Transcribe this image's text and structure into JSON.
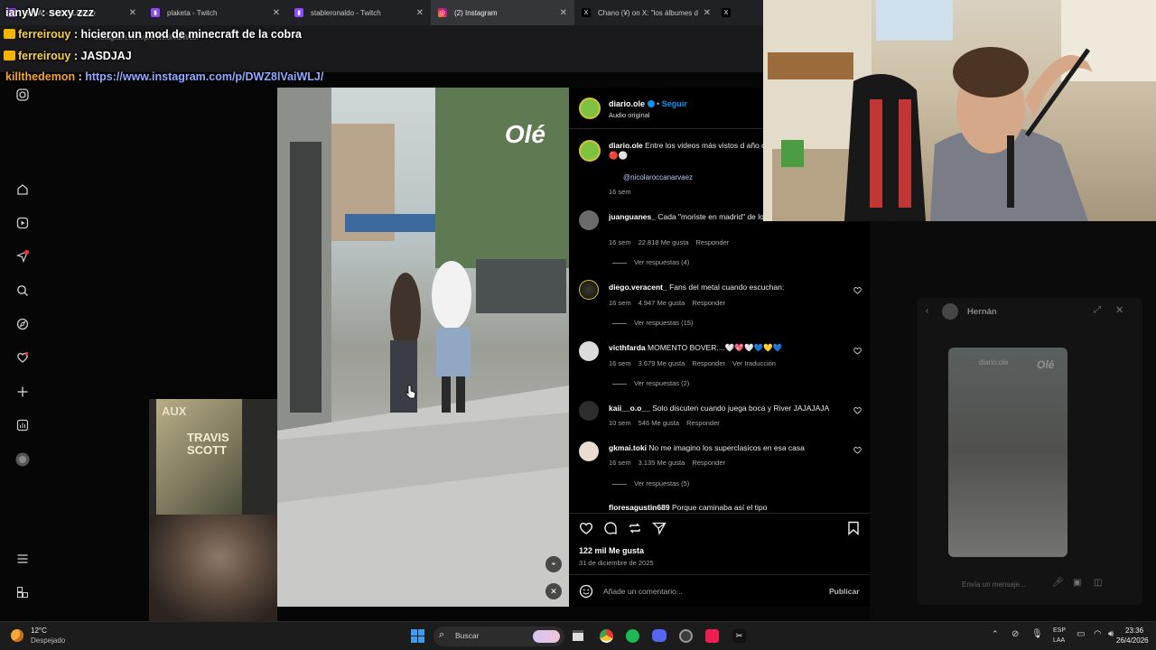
{
  "tabs": [
    {
      "label": "lanyW - Watch Live on"
    },
    {
      "label": "plaketa - Twitch"
    },
    {
      "label": "stableronaldo - Twitch"
    },
    {
      "label": "(2) Instagram"
    },
    {
      "label": "Chano (¥) on X: \"los álbumes de"
    }
  ],
  "url": "instagram.com/p/DWZ8lVaiWLJ/",
  "chat": [
    {
      "user": "ianyW",
      "msg": "sexy zzz"
    },
    {
      "user": "ferreirouy",
      "msg": "hicieron un mod de minecraft de la cobra"
    },
    {
      "user": "ferreirouy",
      "msg": "JASDJAJ"
    },
    {
      "user": "killthedemon",
      "msg": "https://www.instagram.com/p/DWZ8lVaiWLJ/"
    }
  ],
  "post": {
    "watermark": "Olé",
    "account": "diario.ole",
    "follow": "Seguir",
    "audio": "Audio original",
    "caption": "Entre los videos más vistos d año con mucho 💕 amor 🔵🟡🔴⚪",
    "mention": "@nicolaroccanarvaez",
    "caption_age": "16 sem",
    "likes": "122 mil Me gusta",
    "date": "31 de diciembre de 2025",
    "add_comment": "Añade un comentario...",
    "publish": "Publicar"
  },
  "comments": [
    {
      "user": "juanguanes_",
      "text": "Cada \"moriste en madrid\" de local\"",
      "age": "16 sem",
      "likes": "22.818 Me gusta",
      "reply": "Responder",
      "view": "Ver respuestas (4)"
    },
    {
      "user": "diego.veracent_",
      "text": "Fans del metal cuando escuchan:",
      "age": "16 sem",
      "likes": "4.947 Me gusta",
      "reply": "Responder",
      "view": "Ver respuestas (15)"
    },
    {
      "user": "victhfarda",
      "text": "MOMENTO BOVER....🤍💖🤍💙💛💙",
      "age": "16 sem",
      "likes": "3.679 Me gusta",
      "reply": "Responder",
      "translate": "Ver traducción",
      "view": "Ver respuestas (2)"
    },
    {
      "user": "kaii__o.o__",
      "text": "Solo discuten cuando juega boca y River JAJAJAJA",
      "age": "10 sem",
      "likes": "546 Me gusta",
      "reply": "Responder"
    },
    {
      "user": "gkmai.toki",
      "text": "No me imagino los superclasicos en esa casa",
      "age": "16 sem",
      "likes": "3.135 Me gusta",
      "reply": "Responder",
      "view": "Ver respuestas (5)"
    },
    {
      "user": "floresagustin689",
      "text": "Porque caminaba así el tipo"
    }
  ],
  "dm": {
    "name": "Hernán",
    "placeholder": "Envía un mensaje...",
    "card_user": "diario.ole"
  },
  "left_card": {
    "title": "TRAVIS SCOTT",
    "subtitle": "AUX"
  },
  "taskbar": {
    "temp": "12°C",
    "weather": "Despejado",
    "search": "Buscar",
    "lang1": "ESP",
    "lang2": "LAA",
    "time": "23:36",
    "date": "26/4/2026"
  },
  "colors": {
    "accent": "#0095f6",
    "ole": "#7fc241",
    "chat_user": "#f4d03f",
    "chat_link": "#8fa9ff"
  }
}
